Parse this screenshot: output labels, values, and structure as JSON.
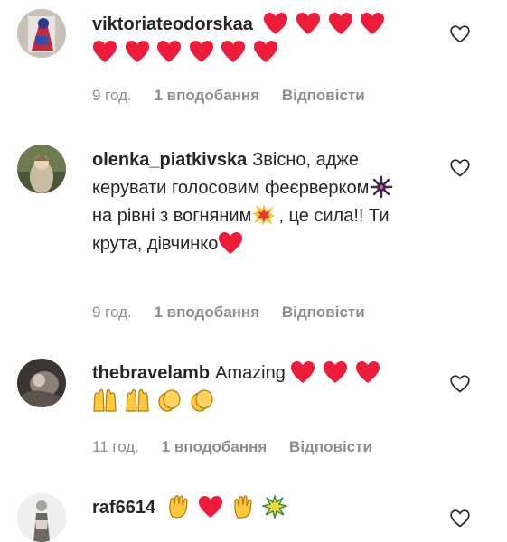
{
  "comments": [
    {
      "username": "viktoriateodorskaa",
      "text": "",
      "emojis": [
        "red-heart",
        "red-heart",
        "red-heart",
        "red-heart",
        "red-heart",
        "red-heart",
        "red-heart",
        "red-heart",
        "red-heart",
        "red-heart"
      ],
      "time": "9 год.",
      "likes": "1 вподобання",
      "reply": "Відповісти"
    },
    {
      "username": "olenka_piatkivska",
      "text_parts": [
        "Звісно, адже керувати голосовим феєрверком",
        " на рівні з вогняним",
        ", це сила!! Ти крута, дівчинко"
      ],
      "emojis": [
        "fireworks-burst",
        "collision",
        "red-heart"
      ],
      "time": "9 год.",
      "likes": "1 вподобання",
      "reply": "Відповісти"
    },
    {
      "username": "thebravelamb",
      "text": "Amazing",
      "emojis": [
        "red-heart",
        "red-heart",
        "red-heart",
        "raising-hands",
        "raising-hands",
        "clapping-hands",
        "clapping-hands"
      ],
      "time": "11 год.",
      "likes": "1 вподобання",
      "reply": "Відповісти"
    },
    {
      "username": "raf6614",
      "text": "",
      "emojis": [
        "waving-hand",
        "red-heart",
        "raised-hand",
        "sparkle-burst"
      ]
    }
  ],
  "colors": {
    "text": "#262626",
    "meta": "#8e8e8e",
    "heart": "#ed1c3a",
    "emoji_yellow": "#ffc83d"
  }
}
